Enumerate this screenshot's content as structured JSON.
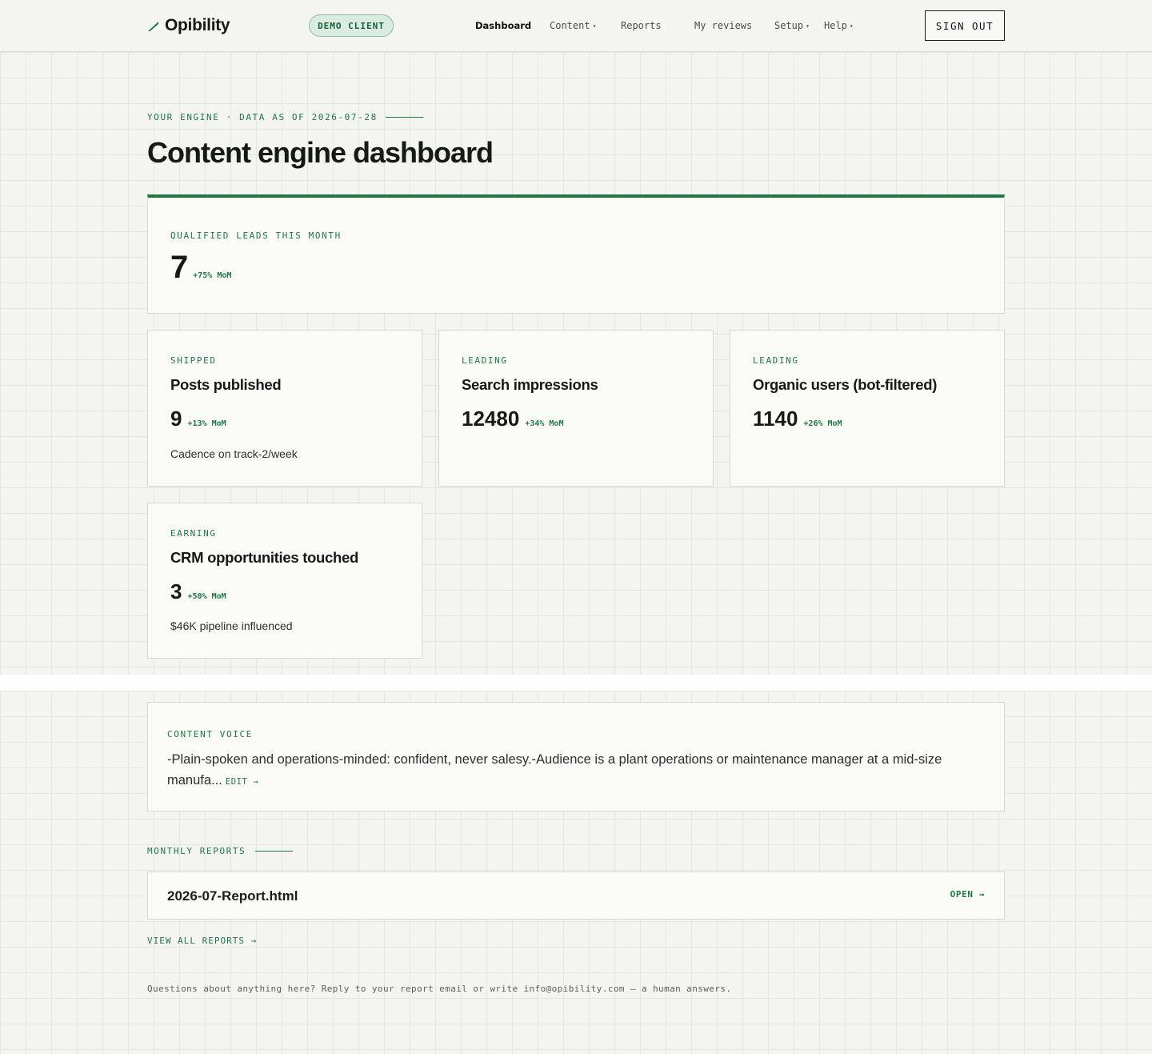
{
  "header": {
    "brand": "Opibility",
    "badge": "DEMO CLIENT",
    "nav": [
      {
        "label": "Dashboard",
        "active": true,
        "dropdown": false
      },
      {
        "label": "Content",
        "active": false,
        "dropdown": true
      },
      {
        "label": "Reports",
        "active": false,
        "dropdown": false
      },
      {
        "label": "My reviews",
        "active": false,
        "dropdown": false
      },
      {
        "label": "Setup",
        "active": false,
        "dropdown": true
      },
      {
        "label": "Help",
        "active": false,
        "dropdown": true
      }
    ],
    "caret": "▾",
    "signout_label": "SIGN OUT"
  },
  "page": {
    "eyebrow": "YOUR ENGINE · DATA AS OF 2026-07-28",
    "title": "Content engine dashboard"
  },
  "hero": {
    "label": "QUALIFIED LEADS THIS MONTH",
    "value": "7",
    "delta": "+75% MoM"
  },
  "metrics": [
    {
      "category": "SHIPPED",
      "title": "Posts published",
      "value": "9",
      "delta": "+13% MoM",
      "note": "Cadence on track-2/week"
    },
    {
      "category": "LEADING",
      "title": "Search impressions",
      "value": "12480",
      "delta": "+34% MoM",
      "note": ""
    },
    {
      "category": "LEADING",
      "title": "Organic users (bot-filtered)",
      "value": "1140",
      "delta": "+26% MoM",
      "note": ""
    },
    {
      "category": "EARNING",
      "title": "CRM opportunities touched",
      "value": "3",
      "delta": "+50% MoM",
      "note": "$46K pipeline influenced"
    }
  ],
  "voice": {
    "label": "CONTENT VOICE",
    "text": "-Plain-spoken and operations-minded: confident, never salesy.-Audience is a plant operations or maintenance manager at a mid-size manufa...",
    "edit_label": "EDIT →"
  },
  "reports": {
    "label": "MONTHLY REPORTS",
    "items": [
      {
        "file": "2026-07-Report.html",
        "open_label": "OPEN →"
      }
    ],
    "view_all": "VIEW ALL REPORTS →"
  },
  "footer": {
    "note": "Questions about anything here? Reply to your report email or write info@opibility.com — a human answers."
  },
  "colors": {
    "accent": "#1e7a45",
    "background": "#f4f5f1",
    "card": "#fafaf7",
    "badge_bg": "#d9ecdf"
  }
}
